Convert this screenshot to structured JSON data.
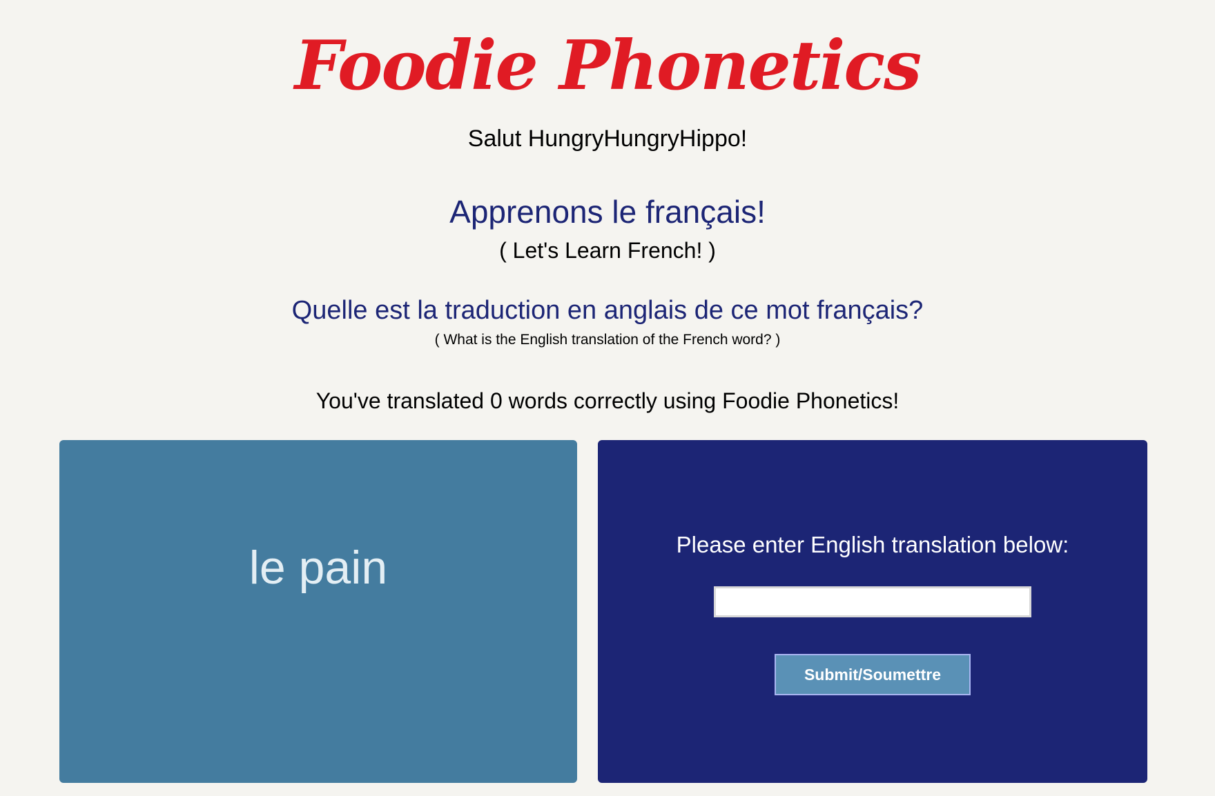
{
  "header": {
    "logo_text": "Foodie Phonetics",
    "greeting": "Salut HungryHungryHippo!"
  },
  "intro": {
    "heading_fr": "Apprenons le français!",
    "heading_en": "( Let's Learn French! )"
  },
  "question": {
    "text_fr": "Quelle est la traduction en anglais de ce mot français?",
    "text_en": "( What is the English translation of the French word? )"
  },
  "progress": {
    "text": "You've translated 0 words correctly using Foodie Phonetics!"
  },
  "word_card": {
    "french_word": "le pain"
  },
  "answer_card": {
    "prompt": "Please enter English translation below:",
    "input_value": "",
    "submit_label": "Submit/Soumettre"
  },
  "colors": {
    "logo": "#e01b24",
    "heading": "#1c2575",
    "word_card_bg": "#447c9f",
    "answer_card_bg": "#1c2575",
    "button_bg": "#5a91b6",
    "page_bg": "#f5f4f0"
  }
}
